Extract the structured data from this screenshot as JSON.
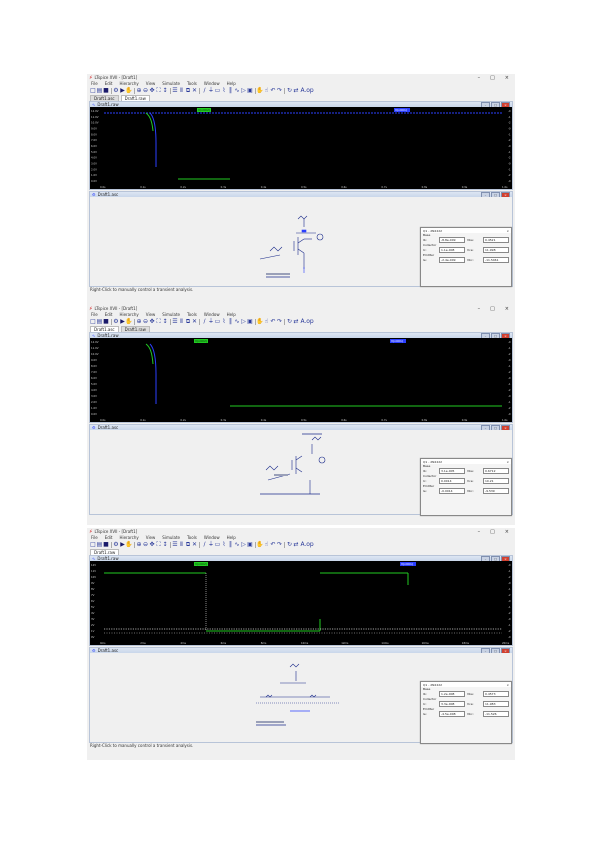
{
  "shots": [
    {
      "window_title": "LTspice XVII - [Draft1]",
      "menu": [
        "File",
        "Edit",
        "Hierarchy",
        "View",
        "Simulate",
        "Tools",
        "Window",
        "Help"
      ],
      "tabs": [
        "Draft1.asc",
        "Draft1.raw"
      ],
      "plot_pane_title": "Draft1.raw",
      "trace_labels": [
        "V(n002)",
        "V(n001)"
      ],
      "schematic_pane_title": "Draft1.asc",
      "popup": {
        "title": "Q1 - 2N2222",
        "group_a": "Base",
        "row1_left": "Ib:",
        "row1_val": "-8.8e-009",
        "row1_right": "Vbe:",
        "row1_rval": "0.4521",
        "group_b": "Collector",
        "row2_left": "Ic:",
        "row2_val": "1.1e-008",
        "row2_right": "Vce:",
        "row2_rval": "11.998",
        "row3_left": "Emitter",
        "row4_left": "Ie:",
        "row4_val": "-2.4e-009",
        "row4_right": "Vbc:",
        "row4_rval": "-11.5461"
      },
      "status": "Right-Click to manually control a transient analysis."
    },
    {
      "window_title": "LTspice XVII - [Draft1]",
      "menu": [
        "File",
        "Edit",
        "Hierarchy",
        "View",
        "Simulate",
        "Tools",
        "Window",
        "Help"
      ],
      "tabs": [
        "Draft1.asc",
        "Draft1.raw"
      ],
      "plot_pane_title": "Draft1.raw",
      "trace_labels": [
        "V(n002)",
        "V(n001)"
      ],
      "schematic_pane_title": "Draft1.asc",
      "popup": {
        "title": "Q1 - 2N2222",
        "group_a": "Base",
        "row1_left": "Ib:",
        "row1_val": "3.1e-005",
        "row1_right": "Vbe:",
        "row1_rval": "0.6712",
        "group_b": "Collector",
        "row2_left": "Ic:",
        "row2_val": "0.0014",
        "row2_right": "Vce:",
        "row2_rval": "10.21",
        "row3_left": "Emitter",
        "row4_left": "Ie:",
        "row4_val": "-0.0014",
        "row4_right": "Vbc:",
        "row4_rval": "-9.539"
      },
      "status": ""
    },
    {
      "window_title": "LTspice XVII - [Draft1]",
      "menu": [
        "File",
        "Edit",
        "Hierarchy",
        "View",
        "Simulate",
        "Tools",
        "Window",
        "Help"
      ],
      "tabs": [
        "Draft1.raw"
      ],
      "plot_pane_title": "Draft1.raw",
      "trace_labels": [
        "V(n002)",
        "V(n001)"
      ],
      "schematic_pane_title": "Draft1.asc",
      "popup": {
        "title": "Q1 - 2N2222",
        "group_a": "Base",
        "row1_left": "Ib:",
        "row1_val": "1.2e-008",
        "row1_right": "Vbe:",
        "row1_rval": "0.4573",
        "group_b": "Collector",
        "row2_left": "Ic:",
        "row2_val": "3.3e-008",
        "row2_right": "Vce:",
        "row2_rval": "11.983",
        "row3_left": "Emitter",
        "row4_left": "Ie:",
        "row4_val": "-4.5e-008",
        "row4_right": "Vbc:",
        "row4_rval": "-11.526"
      },
      "status": "Right-Click to manually control a transient analysis."
    }
  ],
  "toolbar_icons": [
    "new-icon",
    "open-icon",
    "save-icon",
    "control-panel-icon",
    "run-icon",
    "halt-icon",
    "zoom-in-icon",
    "zoom-out-icon",
    "pan-icon",
    "zoom-fit-icon",
    "autorange-icon",
    "tile-horizontal-icon",
    "tile-vertical-icon",
    "cascade-icon",
    "close-window-icon",
    "wire-icon",
    "ground-icon",
    "label-icon",
    "resistor-icon",
    "capacitor-icon",
    "inductor-icon",
    "diode-icon",
    "component-icon",
    "move-icon",
    "drag-icon",
    "undo-icon",
    "redo-icon",
    "rotate-icon",
    "mirror-icon",
    "text-icon",
    "spice-directive-icon"
  ],
  "colors": {
    "accent_green": "#22cc22",
    "accent_blue": "#2b3fff",
    "plot_bg": "#000000",
    "wave_white": "#d8d8d8"
  },
  "plot1": {
    "x_ticks": [
      "0.0s",
      "0.1s",
      "0.2s",
      "0.3s",
      "0.4s",
      "0.5s",
      "0.6s",
      "0.7s",
      "0.8s",
      "0.9s",
      "1.0s"
    ],
    "y_ticks": [
      "12.0V",
      "11.0V",
      "10.0V",
      "9.0V",
      "8.0V",
      "7.0V",
      "6.0V",
      "5.0V",
      "4.0V",
      "3.0V",
      "2.0V",
      "1.0V",
      "0.0V"
    ]
  },
  "plot3": {
    "x_ticks": [
      "0ms",
      "2ms",
      "4ms",
      "6ms",
      "8ms",
      "10ms",
      "12ms",
      "14ms",
      "16ms",
      "18ms",
      "20ms"
    ],
    "y_ticks": [
      "12V",
      "11V",
      "10V",
      "9V",
      "8V",
      "7V",
      "6V",
      "5V",
      "4V",
      "3V",
      "2V",
      "1V",
      "0V"
    ]
  }
}
